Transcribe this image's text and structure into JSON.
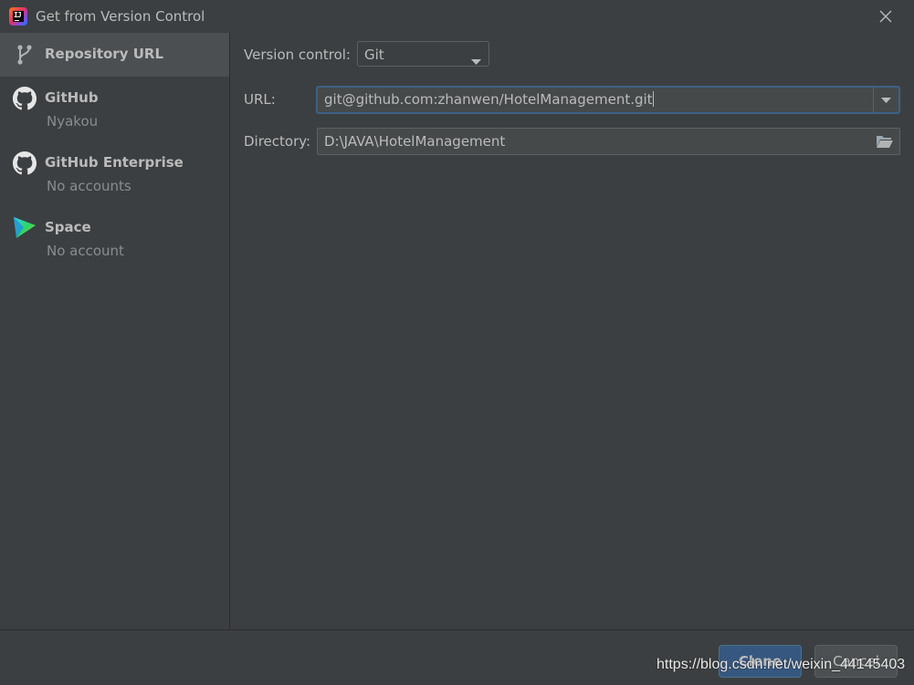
{
  "window": {
    "title": "Get from Version Control",
    "app_icon": "intellij-idea-icon",
    "close_icon": "close-icon"
  },
  "sidebar": {
    "items": [
      {
        "label": "Repository URL",
        "sublabel": "",
        "icon": "vcs-branch-icon",
        "selected": true
      },
      {
        "label": "GitHub",
        "sublabel": "Nyakou",
        "icon": "github-icon"
      },
      {
        "label": "GitHub Enterprise",
        "sublabel": "No accounts",
        "icon": "github-icon"
      },
      {
        "label": "Space",
        "sublabel": "No account",
        "icon": "space-icon"
      }
    ]
  },
  "form": {
    "version_control_label": "Version control:",
    "version_control_value": "Git",
    "url_label": "URL:",
    "url_value": "git@github.com:zhanwen/HotelManagement.git",
    "directory_label": "Directory:",
    "directory_value": "D:\\JAVA\\HotelManagement"
  },
  "footer": {
    "clone_label": "Clone",
    "cancel_label": "Cancel"
  },
  "watermark": "https://blog.csdn.net/weixin_44145403",
  "colors": {
    "background": "#3c3f41",
    "selection": "#4b4f51",
    "focus_border": "#3d6185",
    "primary_button": "#365880"
  }
}
